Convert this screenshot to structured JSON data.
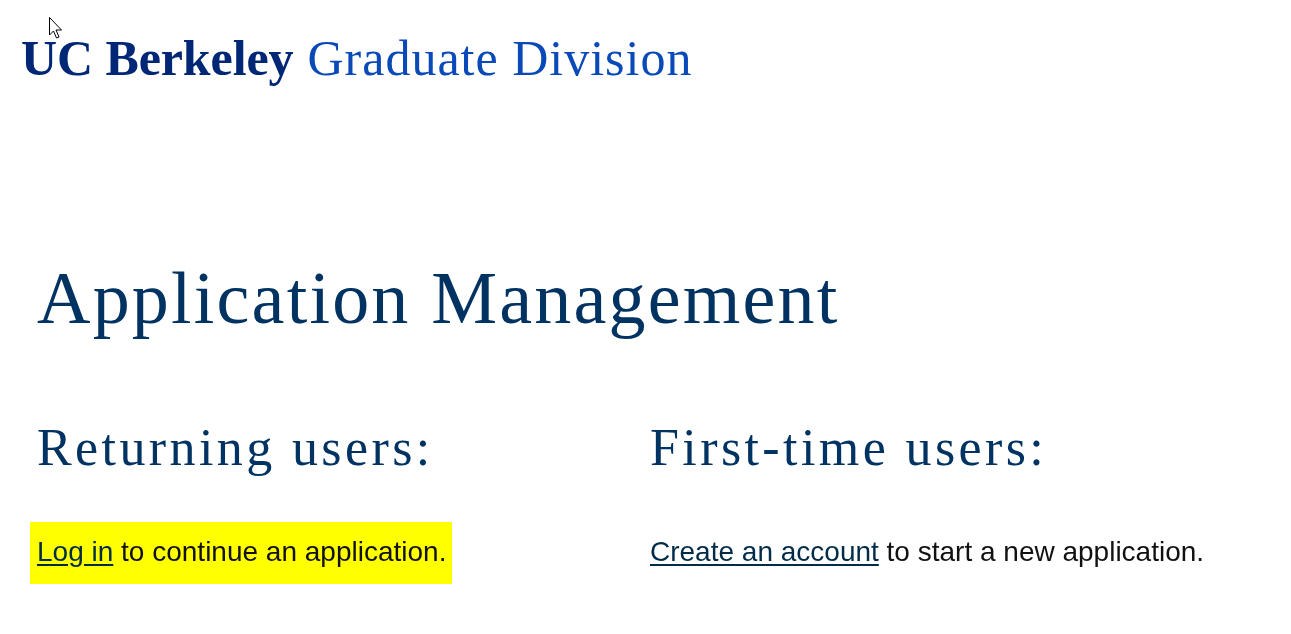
{
  "logo": {
    "primary": "UC Berkeley",
    "secondary": "Graduate Division"
  },
  "title": "Application Management",
  "sections": [
    {
      "heading": "Returning users:",
      "link": "Log in",
      "text": "to continue an application.",
      "highlighted": true
    },
    {
      "heading": "First-time users:",
      "link": "Create an account",
      "text": "to start a new application.",
      "highlighted": false
    }
  ]
}
